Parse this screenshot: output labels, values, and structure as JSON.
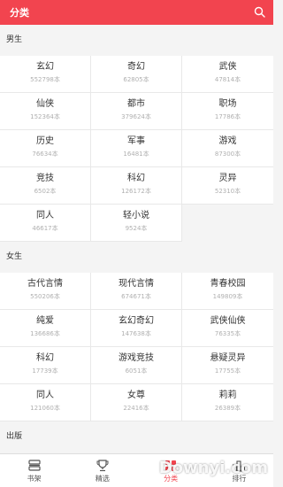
{
  "header": {
    "title": "分类",
    "search_icon": "search-icon"
  },
  "sections": [
    {
      "title": "男生",
      "items": [
        {
          "name": "玄幻",
          "count": "552798本"
        },
        {
          "name": "奇幻",
          "count": "62805本"
        },
        {
          "name": "武侠",
          "count": "47814本"
        },
        {
          "name": "仙侠",
          "count": "152364本"
        },
        {
          "name": "都市",
          "count": "379624本"
        },
        {
          "name": "职场",
          "count": "17786本"
        },
        {
          "name": "历史",
          "count": "76634本"
        },
        {
          "name": "军事",
          "count": "16481本"
        },
        {
          "name": "游戏",
          "count": "87300本"
        },
        {
          "name": "竞技",
          "count": "6502本"
        },
        {
          "name": "科幻",
          "count": "126172本"
        },
        {
          "name": "灵异",
          "count": "52310本"
        },
        {
          "name": "同人",
          "count": "46617本"
        },
        {
          "name": "轻小说",
          "count": "9524本"
        }
      ]
    },
    {
      "title": "女生",
      "items": [
        {
          "name": "古代言情",
          "count": "550206本"
        },
        {
          "name": "现代言情",
          "count": "674671本"
        },
        {
          "name": "青春校园",
          "count": "149809本"
        },
        {
          "name": "纯爱",
          "count": "136686本"
        },
        {
          "name": "玄幻奇幻",
          "count": "147638本"
        },
        {
          "name": "武侠仙侠",
          "count": "76335本"
        },
        {
          "name": "科幻",
          "count": "17739本"
        },
        {
          "name": "游戏竞技",
          "count": "6051本"
        },
        {
          "name": "悬疑灵异",
          "count": "17755本"
        },
        {
          "name": "同人",
          "count": "121060本"
        },
        {
          "name": "女尊",
          "count": "22416本"
        },
        {
          "name": "莉莉",
          "count": "26389本"
        }
      ]
    },
    {
      "title": "出版",
      "items": []
    }
  ],
  "tabs": [
    {
      "label": "书架",
      "icon": "bookshelf-icon",
      "active": false
    },
    {
      "label": "精选",
      "icon": "trophy-icon",
      "active": false
    },
    {
      "label": "分类",
      "icon": "category-icon",
      "active": true
    },
    {
      "label": "排行",
      "icon": "ranking-icon",
      "active": false
    }
  ],
  "watermark": "Downyi.com",
  "colors": {
    "accent": "#f2444f",
    "background": "#f4f4f4"
  }
}
